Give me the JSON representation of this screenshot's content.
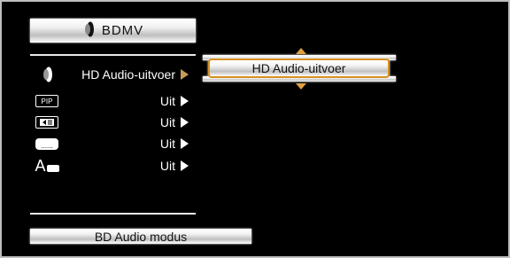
{
  "title_bar": {
    "label": "BDMV",
    "icon": "speaker-icon"
  },
  "menu": {
    "rows": [
      {
        "icon": "speaker-icon",
        "value": "HD Audio-uitvoer",
        "selected": true
      },
      {
        "icon": "pip-icon",
        "icon_text": "PIP",
        "value": "Uit"
      },
      {
        "icon": "secondary-audio-icon",
        "value": "Uit"
      },
      {
        "icon": "subtitle-icon",
        "value": "Uit"
      },
      {
        "icon": "subtitle-style-icon",
        "icon_text": "A",
        "value": "Uit"
      }
    ]
  },
  "popup": {
    "option": "HD Audio-uitvoer"
  },
  "footer": {
    "label": "BD Audio modus"
  },
  "colors": {
    "highlight_border": "#d89020",
    "active_arrow": "#c89a5a"
  }
}
